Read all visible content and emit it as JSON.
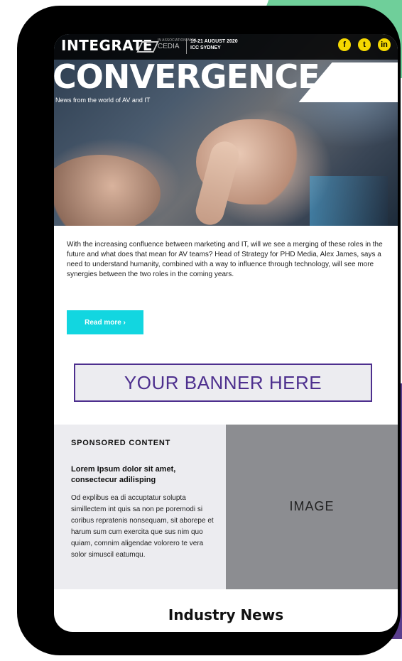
{
  "header": {
    "brand": "INTEGRATE",
    "partner_small": "IN ASSOCIATION WITH",
    "partner": "CEDIA",
    "event_date": "19-21 AUGUST 2020",
    "event_venue": "ICC SYDNEY",
    "social": [
      {
        "name": "facebook",
        "glyph": "f"
      },
      {
        "name": "twitter",
        "glyph": "t"
      },
      {
        "name": "linkedin",
        "glyph": "in"
      }
    ],
    "social_color": "#f5d800"
  },
  "hero": {
    "title": "CONVERGENCE",
    "subtitle": "News from the world of AV and IT"
  },
  "intro": {
    "text": "With the increasing confluence between marketing and IT, will we see a merging of these roles in the future and what does that mean for AV teams? Head of Strategy for PHD Media, Alex James, says a need to understand humanity, combined with a way to influence through technology, will see more synergies between the two roles in the coming years.",
    "button_label": "Read more ›",
    "button_color": "#12d6e0"
  },
  "banner": {
    "text": "YOUR BANNER HERE",
    "color": "#4d2f8e"
  },
  "sponsored": {
    "heading": "SPONSORED CONTENT",
    "title": "Lorem Ipsum dolor sit amet, consectecur adilisping",
    "body": "Od explibus ea di accuptatur solupta simillectem int quis sa non pe poremodi si coribus repratenis nonsequam, sit aborepe et harum sum cum exercita que sus nim quo quiam, comnim aligendae volorero te vera solor simuscil eatumqu.",
    "image_label": "IMAGE"
  },
  "news": {
    "title": "Industry News"
  }
}
